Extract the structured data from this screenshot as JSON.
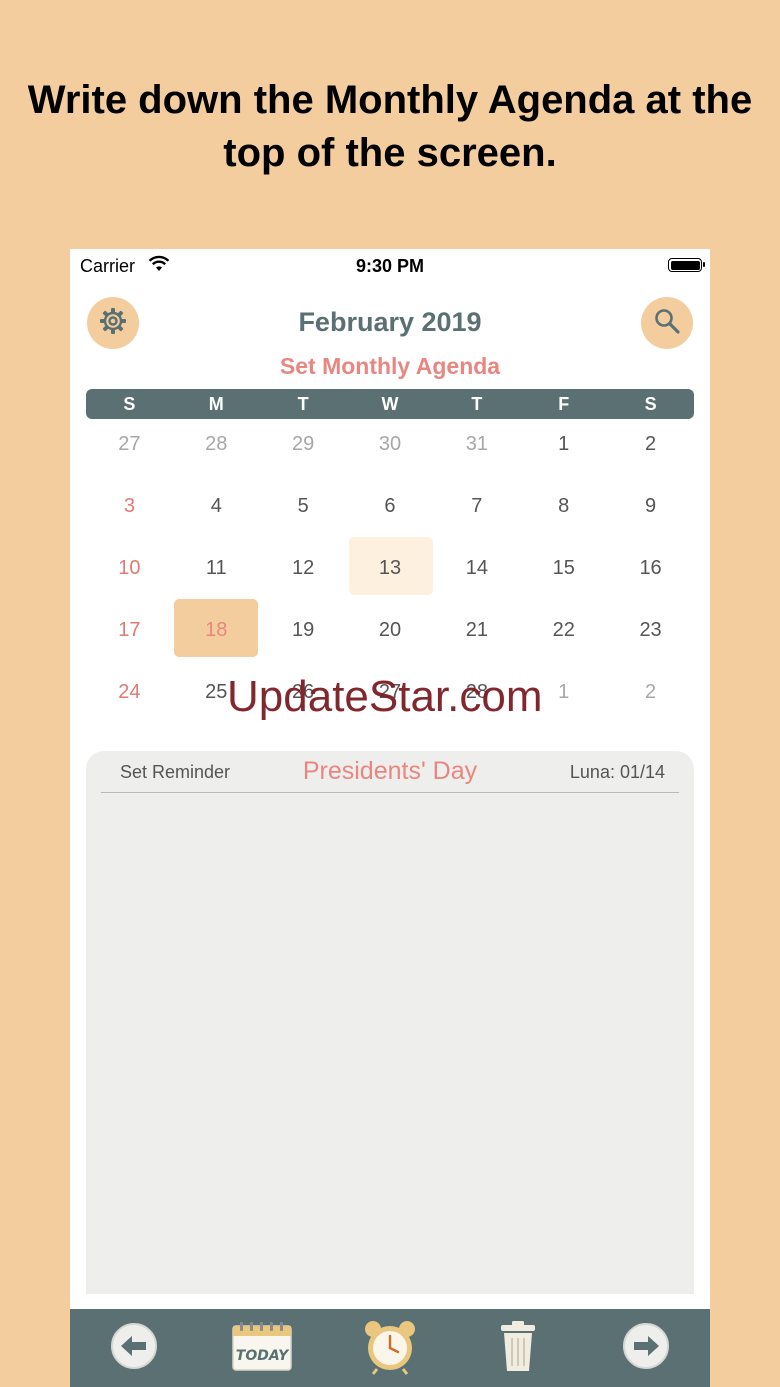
{
  "caption": "Write down the Monthly Agenda at the top of the screen.",
  "status_bar": {
    "carrier": "Carrier",
    "time": "9:30 PM"
  },
  "header": {
    "month": "February 2019",
    "agenda_link": "Set Monthly Agenda"
  },
  "weekdays": [
    "S",
    "M",
    "T",
    "W",
    "T",
    "F",
    "S"
  ],
  "days": [
    {
      "label": "27",
      "state": "muted"
    },
    {
      "label": "28",
      "state": "muted"
    },
    {
      "label": "29",
      "state": "muted"
    },
    {
      "label": "30",
      "state": "muted"
    },
    {
      "label": "31",
      "state": "muted"
    },
    {
      "label": "1",
      "state": "normal"
    },
    {
      "label": "2",
      "state": "normal"
    },
    {
      "label": "3",
      "state": "sunday"
    },
    {
      "label": "4",
      "state": "normal"
    },
    {
      "label": "5",
      "state": "normal"
    },
    {
      "label": "6",
      "state": "normal"
    },
    {
      "label": "7",
      "state": "normal"
    },
    {
      "label": "8",
      "state": "normal"
    },
    {
      "label": "9",
      "state": "normal"
    },
    {
      "label": "10",
      "state": "sunday"
    },
    {
      "label": "11",
      "state": "normal"
    },
    {
      "label": "12",
      "state": "normal"
    },
    {
      "label": "13",
      "state": "today"
    },
    {
      "label": "14",
      "state": "normal"
    },
    {
      "label": "15",
      "state": "normal"
    },
    {
      "label": "16",
      "state": "normal"
    },
    {
      "label": "17",
      "state": "sunday"
    },
    {
      "label": "18",
      "state": "selected"
    },
    {
      "label": "19",
      "state": "normal"
    },
    {
      "label": "20",
      "state": "normal"
    },
    {
      "label": "21",
      "state": "normal"
    },
    {
      "label": "22",
      "state": "normal"
    },
    {
      "label": "23",
      "state": "normal"
    },
    {
      "label": "24",
      "state": "sunday"
    },
    {
      "label": "25",
      "state": "normal"
    },
    {
      "label": "26",
      "state": "normal"
    },
    {
      "label": "27",
      "state": "normal"
    },
    {
      "label": "28",
      "state": "normal"
    },
    {
      "label": "1",
      "state": "muted"
    },
    {
      "label": "2",
      "state": "muted"
    }
  ],
  "watermark": "UpdateStar.com",
  "reminder_panel": {
    "set_reminder": "Set Reminder",
    "holiday": "Presidents' Day",
    "luna": "Luna: 01/14"
  },
  "toolbar": {
    "today_label": "TODAY",
    "icons": [
      "back-arrow-icon",
      "today-calendar-icon",
      "alarm-clock-icon",
      "trash-icon",
      "forward-arrow-icon"
    ]
  },
  "colors": {
    "background": "#f4cd9e",
    "accent_slate": "#5a7072",
    "accent_coral": "#e98680",
    "today_highlight": "#fdf0df"
  }
}
